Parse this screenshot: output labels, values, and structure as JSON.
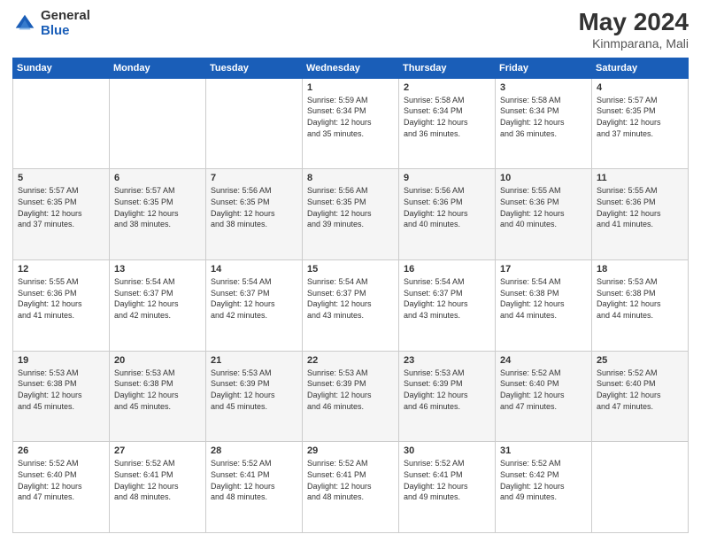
{
  "logo": {
    "general": "General",
    "blue": "Blue"
  },
  "title": "May 2024",
  "subtitle": "Kinmparana, Mali",
  "days_header": [
    "Sunday",
    "Monday",
    "Tuesday",
    "Wednesday",
    "Thursday",
    "Friday",
    "Saturday"
  ],
  "weeks": [
    [
      {
        "day": "",
        "info": ""
      },
      {
        "day": "",
        "info": ""
      },
      {
        "day": "",
        "info": ""
      },
      {
        "day": "1",
        "info": "Sunrise: 5:59 AM\nSunset: 6:34 PM\nDaylight: 12 hours\nand 35 minutes."
      },
      {
        "day": "2",
        "info": "Sunrise: 5:58 AM\nSunset: 6:34 PM\nDaylight: 12 hours\nand 36 minutes."
      },
      {
        "day": "3",
        "info": "Sunrise: 5:58 AM\nSunset: 6:34 PM\nDaylight: 12 hours\nand 36 minutes."
      },
      {
        "day": "4",
        "info": "Sunrise: 5:57 AM\nSunset: 6:35 PM\nDaylight: 12 hours\nand 37 minutes."
      }
    ],
    [
      {
        "day": "5",
        "info": "Sunrise: 5:57 AM\nSunset: 6:35 PM\nDaylight: 12 hours\nand 37 minutes."
      },
      {
        "day": "6",
        "info": "Sunrise: 5:57 AM\nSunset: 6:35 PM\nDaylight: 12 hours\nand 38 minutes."
      },
      {
        "day": "7",
        "info": "Sunrise: 5:56 AM\nSunset: 6:35 PM\nDaylight: 12 hours\nand 38 minutes."
      },
      {
        "day": "8",
        "info": "Sunrise: 5:56 AM\nSunset: 6:35 PM\nDaylight: 12 hours\nand 39 minutes."
      },
      {
        "day": "9",
        "info": "Sunrise: 5:56 AM\nSunset: 6:36 PM\nDaylight: 12 hours\nand 40 minutes."
      },
      {
        "day": "10",
        "info": "Sunrise: 5:55 AM\nSunset: 6:36 PM\nDaylight: 12 hours\nand 40 minutes."
      },
      {
        "day": "11",
        "info": "Sunrise: 5:55 AM\nSunset: 6:36 PM\nDaylight: 12 hours\nand 41 minutes."
      }
    ],
    [
      {
        "day": "12",
        "info": "Sunrise: 5:55 AM\nSunset: 6:36 PM\nDaylight: 12 hours\nand 41 minutes."
      },
      {
        "day": "13",
        "info": "Sunrise: 5:54 AM\nSunset: 6:37 PM\nDaylight: 12 hours\nand 42 minutes."
      },
      {
        "day": "14",
        "info": "Sunrise: 5:54 AM\nSunset: 6:37 PM\nDaylight: 12 hours\nand 42 minutes."
      },
      {
        "day": "15",
        "info": "Sunrise: 5:54 AM\nSunset: 6:37 PM\nDaylight: 12 hours\nand 43 minutes."
      },
      {
        "day": "16",
        "info": "Sunrise: 5:54 AM\nSunset: 6:37 PM\nDaylight: 12 hours\nand 43 minutes."
      },
      {
        "day": "17",
        "info": "Sunrise: 5:54 AM\nSunset: 6:38 PM\nDaylight: 12 hours\nand 44 minutes."
      },
      {
        "day": "18",
        "info": "Sunrise: 5:53 AM\nSunset: 6:38 PM\nDaylight: 12 hours\nand 44 minutes."
      }
    ],
    [
      {
        "day": "19",
        "info": "Sunrise: 5:53 AM\nSunset: 6:38 PM\nDaylight: 12 hours\nand 45 minutes."
      },
      {
        "day": "20",
        "info": "Sunrise: 5:53 AM\nSunset: 6:38 PM\nDaylight: 12 hours\nand 45 minutes."
      },
      {
        "day": "21",
        "info": "Sunrise: 5:53 AM\nSunset: 6:39 PM\nDaylight: 12 hours\nand 45 minutes."
      },
      {
        "day": "22",
        "info": "Sunrise: 5:53 AM\nSunset: 6:39 PM\nDaylight: 12 hours\nand 46 minutes."
      },
      {
        "day": "23",
        "info": "Sunrise: 5:53 AM\nSunset: 6:39 PM\nDaylight: 12 hours\nand 46 minutes."
      },
      {
        "day": "24",
        "info": "Sunrise: 5:52 AM\nSunset: 6:40 PM\nDaylight: 12 hours\nand 47 minutes."
      },
      {
        "day": "25",
        "info": "Sunrise: 5:52 AM\nSunset: 6:40 PM\nDaylight: 12 hours\nand 47 minutes."
      }
    ],
    [
      {
        "day": "26",
        "info": "Sunrise: 5:52 AM\nSunset: 6:40 PM\nDaylight: 12 hours\nand 47 minutes."
      },
      {
        "day": "27",
        "info": "Sunrise: 5:52 AM\nSunset: 6:41 PM\nDaylight: 12 hours\nand 48 minutes."
      },
      {
        "day": "28",
        "info": "Sunrise: 5:52 AM\nSunset: 6:41 PM\nDaylight: 12 hours\nand 48 minutes."
      },
      {
        "day": "29",
        "info": "Sunrise: 5:52 AM\nSunset: 6:41 PM\nDaylight: 12 hours\nand 48 minutes."
      },
      {
        "day": "30",
        "info": "Sunrise: 5:52 AM\nSunset: 6:41 PM\nDaylight: 12 hours\nand 49 minutes."
      },
      {
        "day": "31",
        "info": "Sunrise: 5:52 AM\nSunset: 6:42 PM\nDaylight: 12 hours\nand 49 minutes."
      },
      {
        "day": "",
        "info": ""
      }
    ]
  ]
}
